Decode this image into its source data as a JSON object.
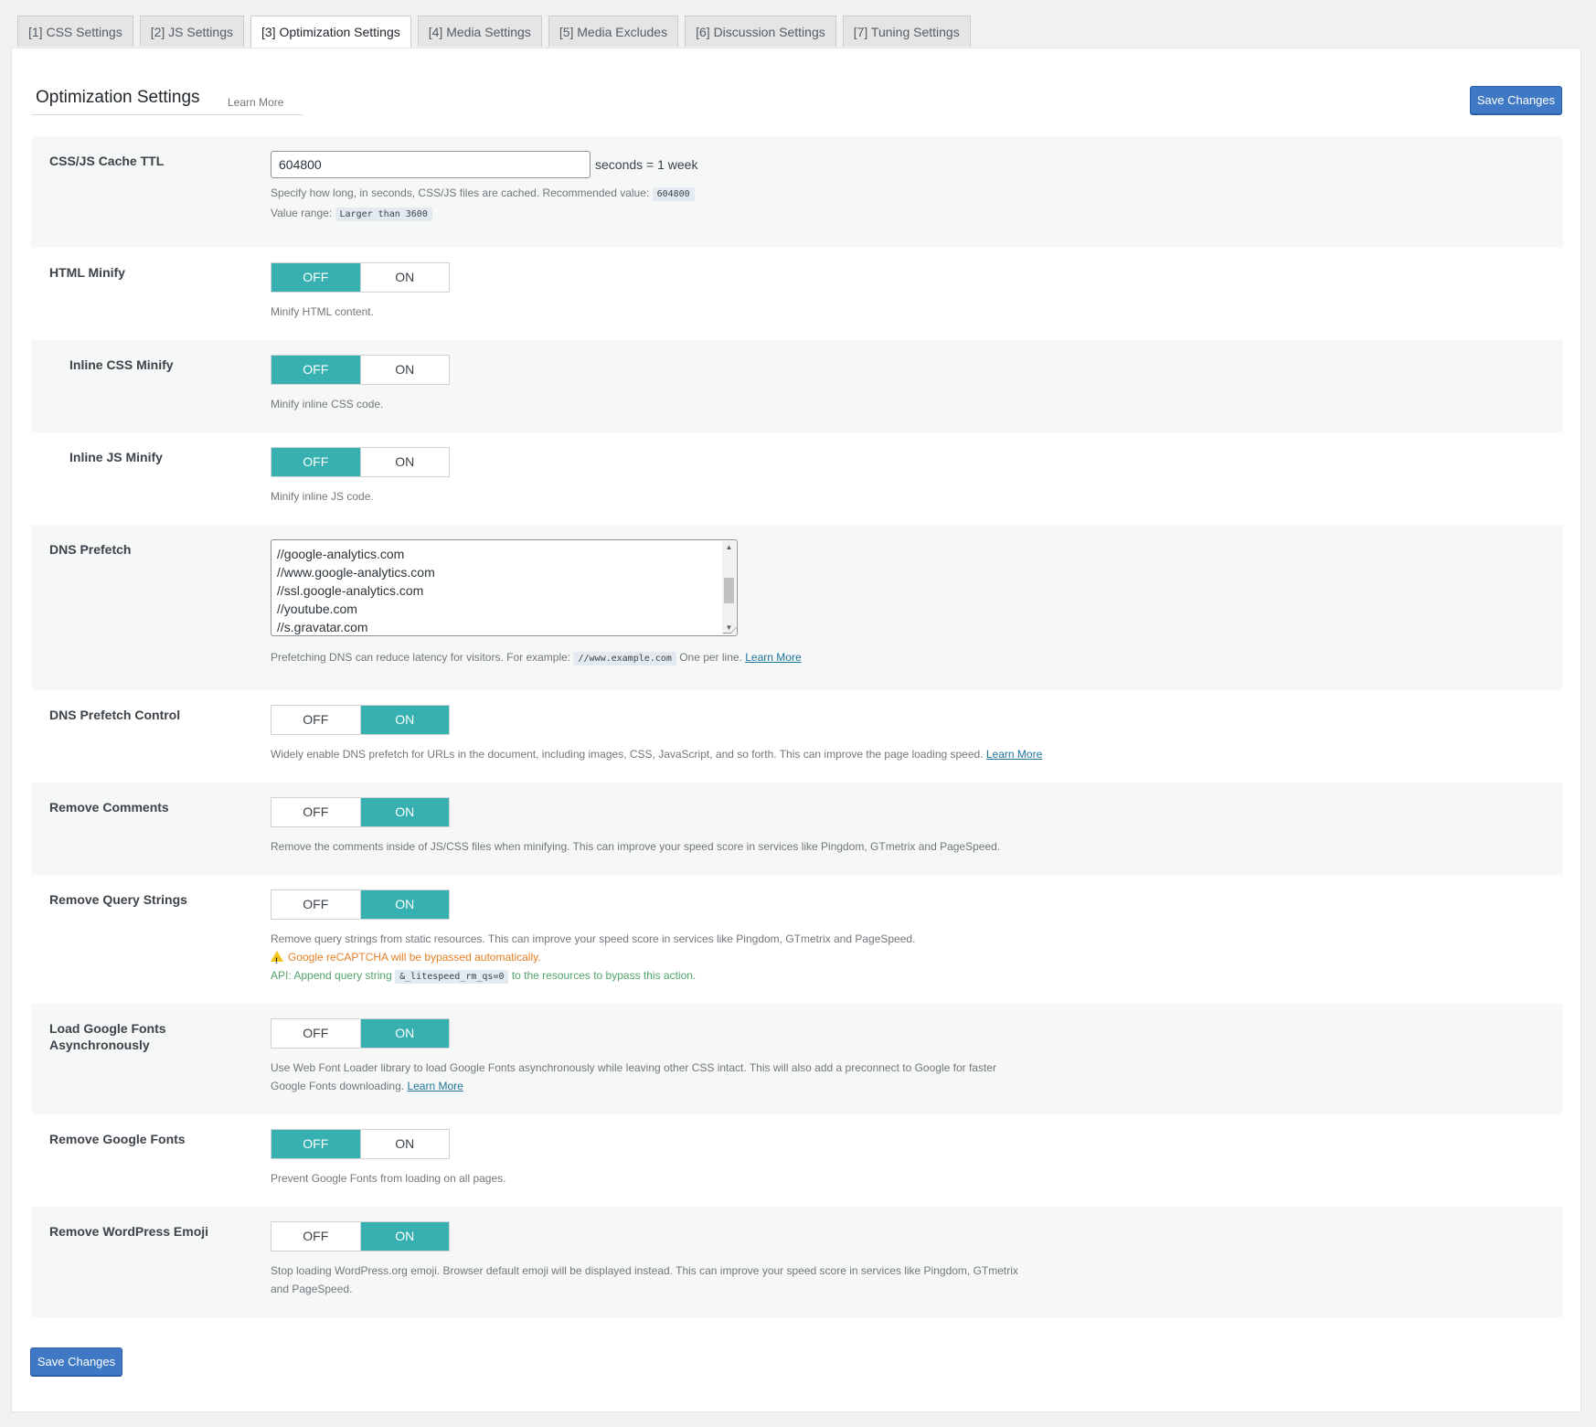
{
  "tabs": [
    {
      "label": "[1] CSS Settings",
      "active": false
    },
    {
      "label": "[2] JS Settings",
      "active": false
    },
    {
      "label": "[3] Optimization Settings",
      "active": true
    },
    {
      "label": "[4] Media Settings",
      "active": false
    },
    {
      "label": "[5] Media Excludes",
      "active": false
    },
    {
      "label": "[6] Discussion Settings",
      "active": false
    },
    {
      "label": "[7] Tuning Settings",
      "active": false
    }
  ],
  "header": {
    "title": "Optimization Settings",
    "learn_more": "Learn More",
    "save_label": "Save Changes"
  },
  "toggle_labels": {
    "off": "OFF",
    "on": "ON"
  },
  "cache_ttl": {
    "label": "CSS/JS Cache TTL",
    "value": "604800",
    "suffix": "seconds = 1 week",
    "desc": "Specify how long, in seconds, CSS/JS files are cached. Recommended value:",
    "recommended": "604800",
    "range_label": "Value range:",
    "range_value": "Larger than 3600"
  },
  "html_minify": {
    "label": "HTML Minify",
    "state": "off",
    "desc": "Minify HTML content."
  },
  "inline_css_minify": {
    "label": "Inline CSS Minify",
    "state": "off",
    "desc": "Minify inline CSS code."
  },
  "inline_js_minify": {
    "label": "Inline JS Minify",
    "state": "off",
    "desc": "Minify inline JS code."
  },
  "dns_prefetch": {
    "label": "DNS Prefetch",
    "lines": [
      "//google-analytics.com",
      "//www.google-analytics.com",
      "//ssl.google-analytics.com",
      "//youtube.com",
      "//s.gravatar.com"
    ],
    "desc": "Prefetching DNS can reduce latency for visitors. For example:",
    "example": "//www.example.com",
    "desc_after": "One per line.",
    "learn_more": "Learn More"
  },
  "dns_prefetch_control": {
    "label": "DNS Prefetch Control",
    "state": "on",
    "desc": "Widely enable DNS prefetch for URLs in the document, including images, CSS, JavaScript, and so forth. This can improve the page loading speed.",
    "learn_more": "Learn More"
  },
  "remove_comments": {
    "label": "Remove Comments",
    "state": "on",
    "desc": "Remove the comments inside of JS/CSS files when minifying. This can improve your speed score in services like Pingdom, GTmetrix and PageSpeed."
  },
  "remove_query_strings": {
    "label": "Remove Query Strings",
    "state": "on",
    "desc": "Remove query strings from static resources. This can improve your speed score in services like Pingdom, GTmetrix and PageSpeed.",
    "warning": "Google reCAPTCHA will be bypassed automatically.",
    "api_before": "API: Append query string",
    "api_code": "&_litespeed_rm_qs=0",
    "api_after": "to the resources to bypass this action."
  },
  "load_google_fonts_async": {
    "label": "Load Google Fonts Asynchronously",
    "state": "on",
    "desc": "Use Web Font Loader library to load Google Fonts asynchronously while leaving other CSS intact. This will also add a preconnect to Google for faster Google Fonts downloading.",
    "learn_more": "Learn More"
  },
  "remove_google_fonts": {
    "label": "Remove Google Fonts",
    "state": "off",
    "desc": "Prevent Google Fonts from loading on all pages."
  },
  "remove_emoji": {
    "label": "Remove WordPress Emoji",
    "state": "on",
    "desc": "Stop loading WordPress.org emoji. Browser default emoji will be displayed instead. This can improve your speed score in services like Pingdom, GTmetrix and PageSpeed."
  },
  "colors": {
    "toggle_active": "#36b0b0",
    "button": "#3f78c4"
  }
}
